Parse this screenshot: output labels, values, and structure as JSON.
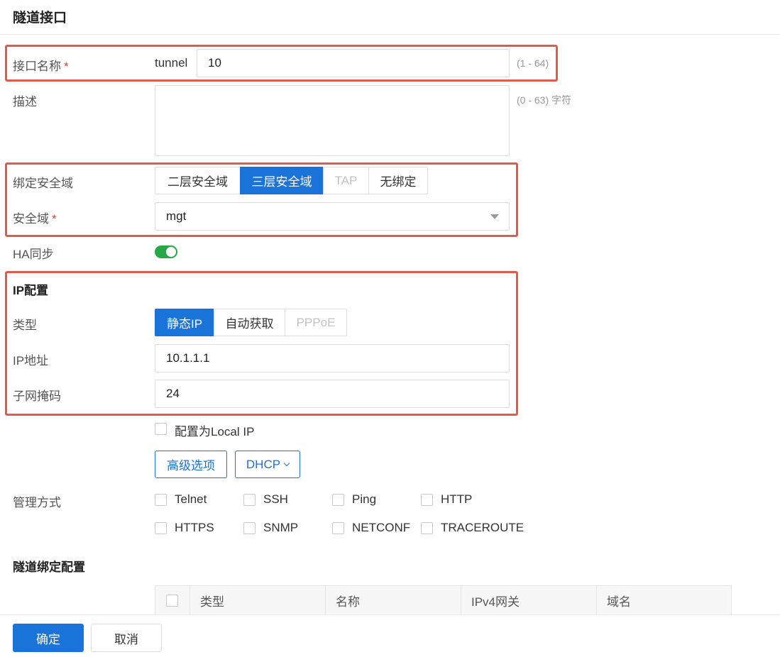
{
  "page": {
    "title": "隧道接口"
  },
  "interface_name": {
    "label": "接口名称",
    "required_mark": "*",
    "prefix": "tunnel",
    "value": "10",
    "hint": "(1 - 64)"
  },
  "description": {
    "label": "描述",
    "value": "",
    "hint": "(0 - 63) 字符"
  },
  "bind_zone": {
    "label": "绑定安全域",
    "options": [
      {
        "label": "二层安全域",
        "state": "normal"
      },
      {
        "label": "三层安全域",
        "state": "active"
      },
      {
        "label": "TAP",
        "state": "disabled"
      },
      {
        "label": "无绑定",
        "state": "normal"
      }
    ]
  },
  "zone": {
    "label": "安全域",
    "required_mark": "*",
    "value": "mgt"
  },
  "ha_sync": {
    "label": "HA同步",
    "on": true
  },
  "ip_config": {
    "section_title": "IP配置",
    "type": {
      "label": "类型",
      "options": [
        {
          "label": "静态IP",
          "state": "active"
        },
        {
          "label": "自动获取",
          "state": "normal"
        },
        {
          "label": "PPPoE",
          "state": "disabled"
        }
      ]
    },
    "ip_address": {
      "label": "IP地址",
      "value": "10.1.1.1"
    },
    "netmask": {
      "label": "子网掩码",
      "value": "24"
    },
    "local_ip": {
      "label": "配置为Local IP",
      "checked": false
    },
    "advanced_button": "高级选项",
    "dhcp_button": "DHCP"
  },
  "management": {
    "label": "管理方式",
    "options": [
      "Telnet",
      "SSH",
      "Ping",
      "HTTP",
      "HTTPS",
      "SNMP",
      "NETCONF",
      "TRACEROUTE"
    ]
  },
  "tunnel_binding": {
    "section_title": "隧道绑定配置",
    "columns": [
      "类型",
      "名称",
      "IPv4网关",
      "域名"
    ]
  },
  "footer": {
    "ok": "确定",
    "cancel": "取消"
  },
  "colors": {
    "primary": "#1a73d9",
    "highlight": "#e05a4e",
    "toggle_on": "#27a844",
    "required": "#e53935"
  }
}
